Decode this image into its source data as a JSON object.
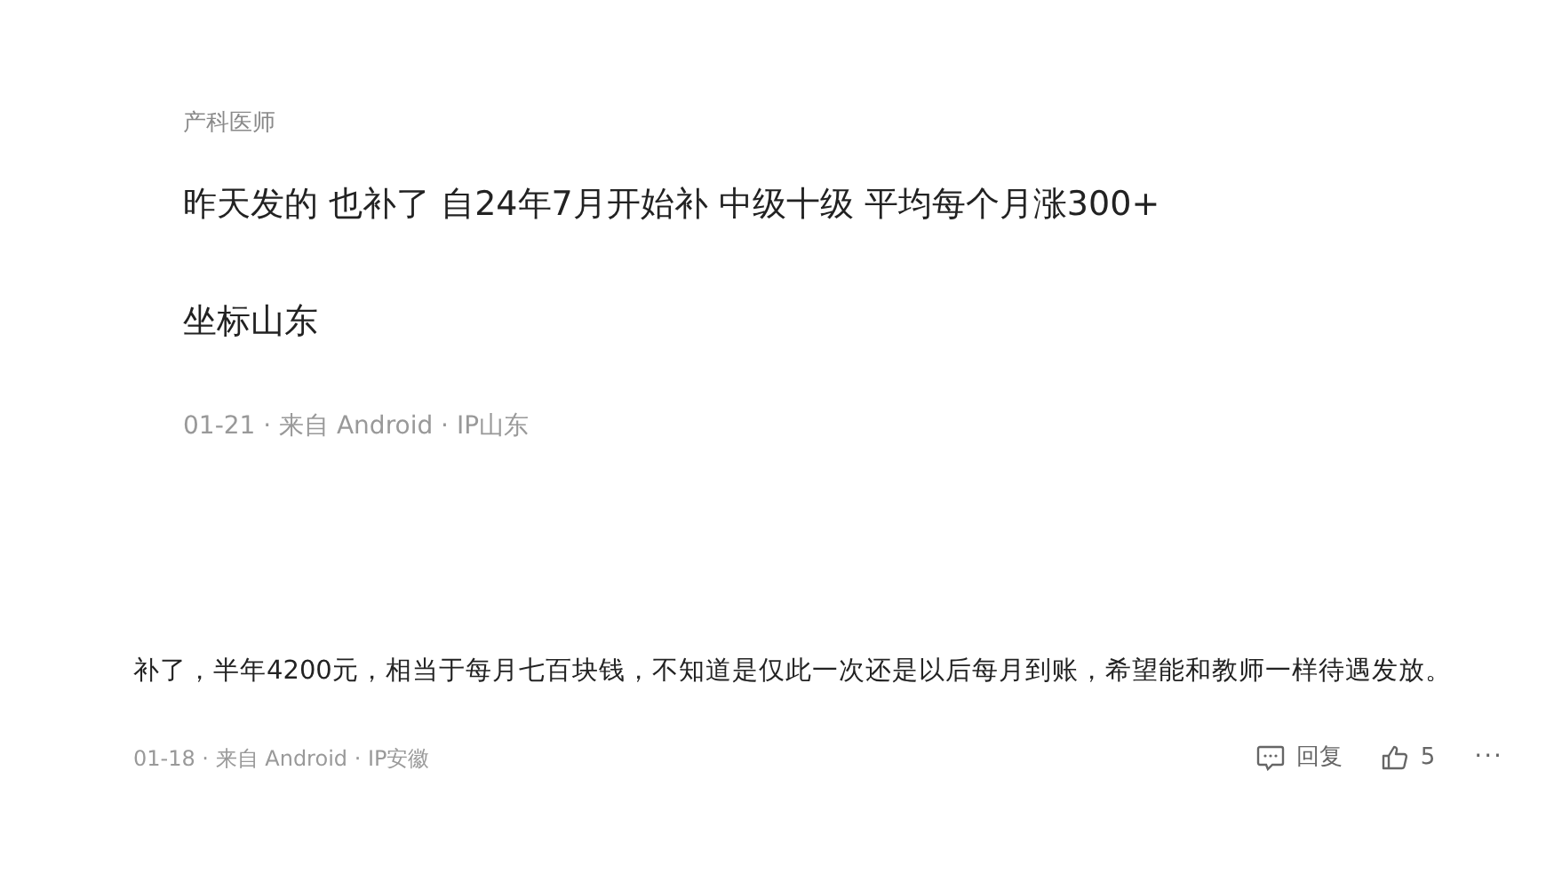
{
  "comments": [
    {
      "author_title": "产科医师",
      "paragraphs": [
        "昨天发的 也补了 自24年7月开始补 中级十级 平均每个月涨300+",
        "坐标山东"
      ],
      "meta": "01-21 · 来自 Android · IP山东"
    },
    {
      "paragraphs": [
        "补了，半年4200元，相当于每月七百块钱，不知道是仅此一次还是以后每月到账，希望能和教师一样待遇发放。"
      ],
      "meta": "01-18 · 来自 Android · IP安徽",
      "reply_label": "回复",
      "likes": "5",
      "more": "···"
    }
  ]
}
